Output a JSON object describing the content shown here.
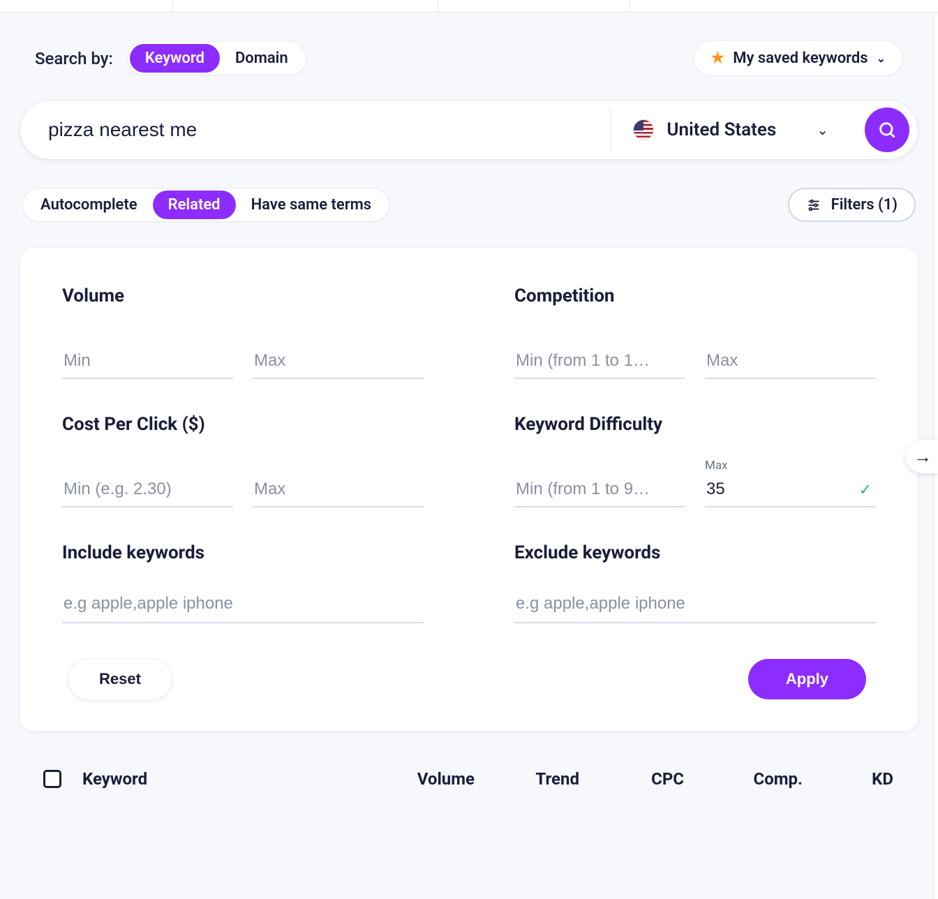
{
  "search_by": {
    "label": "Search by:",
    "options": [
      "Keyword",
      "Domain"
    ],
    "active": "Keyword"
  },
  "saved_keywords_label": "My saved keywords",
  "search": {
    "value": "pizza nearest me",
    "country": "United States"
  },
  "result_tabs": {
    "options": [
      "Autocomplete",
      "Related",
      "Have same terms"
    ],
    "active": "Related"
  },
  "filters_button": {
    "label": "Filters",
    "count": 1
  },
  "filters": {
    "volume": {
      "title": "Volume",
      "min_placeholder": "Min",
      "max_placeholder": "Max",
      "min": "",
      "max": ""
    },
    "competition": {
      "title": "Competition",
      "min_placeholder": "Min (from 1 to 1…",
      "max_placeholder": "Max",
      "min": "",
      "max": ""
    },
    "cpc": {
      "title": "Cost Per Click ($)",
      "min_placeholder": "Min (e.g. 2.30)",
      "max_placeholder": "Max",
      "min": "",
      "max": ""
    },
    "kd": {
      "title": "Keyword Difficulty",
      "min_placeholder": "Min (from 1 to 9…",
      "max_label": "Max",
      "min": "",
      "max": "35"
    },
    "include": {
      "title": "Include keywords",
      "placeholder": "e.g apple,apple iphone",
      "value": ""
    },
    "exclude": {
      "title": "Exclude keywords",
      "placeholder": "e.g apple,apple iphone",
      "value": ""
    },
    "reset_label": "Reset",
    "apply_label": "Apply"
  },
  "results": {
    "columns": {
      "keyword": "Keyword",
      "volume": "Volume",
      "trend": "Trend",
      "cpc": "CPC",
      "comp": "Comp.",
      "kd": "KD"
    }
  },
  "filters_button_composed": "Filters (1)"
}
